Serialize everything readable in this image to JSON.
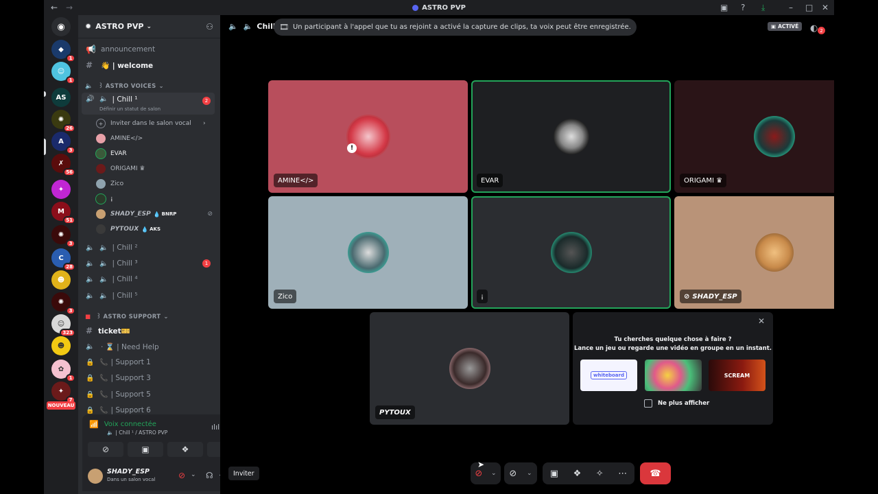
{
  "window": {
    "title": "ASTRO PVP"
  },
  "guilds": [
    {
      "badge": ""
    },
    {
      "badge": "1"
    },
    {
      "badge": "1"
    },
    {
      "badge": ""
    },
    {
      "badge": "26"
    },
    {
      "badge": "3"
    },
    {
      "badge": "56"
    },
    {
      "badge": ""
    },
    {
      "badge": "51"
    },
    {
      "badge": "3"
    },
    {
      "badge": "28"
    },
    {
      "badge": "3"
    },
    {
      "badge": "3"
    },
    {
      "badge": "323"
    },
    {
      "badge": ""
    },
    {
      "badge": "1"
    },
    {
      "badge": "7"
    }
  ],
  "guild_new_label": "NOUVEAU",
  "server": {
    "name": "ASTRO PVP"
  },
  "channels": {
    "announcement": "announcement",
    "welcome": "👋 | welcome",
    "cat_voices": "꒱ ASTRO VOICES",
    "chill1": "| Chill ¹",
    "chill1_badge": "2",
    "chill1_status": "Définir un statut de salon",
    "invite": "Inviter dans le salon vocal",
    "users": [
      "AMINE</>",
      "EVAR",
      "ORIGAMI ♛",
      "Zico",
      "¡",
      "𝙎𝙃𝘼𝘿𝙔_𝙀𝙎𝙋",
      "𝙋𝙔𝙏𝙊𝙐𝙓"
    ],
    "shady_tag": "BNRP",
    "pytoux_tag": "AKS",
    "chill2": "| Chill ²",
    "chill3": "| Chill ³",
    "chill3_badge": "1",
    "chill4": "| Chill ⁴",
    "chill5": "| Chill ⁵",
    "cat_support": "꒱ ASTRO SUPPORT",
    "ticket": "ticket🎫",
    "need_help": "· ⌛ | Need Help",
    "support1": "| Support 1",
    "support3": "| Support 3",
    "support5": "| Support 5",
    "support6": "| Support 6"
  },
  "voice_panel": {
    "status": "Voix connectée",
    "channel": "| Chill ¹ / ASTRO PVP"
  },
  "user_panel": {
    "name": "𝙎𝙃𝘼𝘿𝙔_𝙀𝙎𝙋",
    "status": "Dans un salon vocal"
  },
  "header": {
    "channel": "Chill",
    "toast": "Un participant à l'appel que tu as rejoint a activé la capture de clips, ta voix peut être enregistrée.",
    "active_label": "ACTIVÉ",
    "inbox_badge": "2"
  },
  "tiles": [
    {
      "name": "AMINE</>"
    },
    {
      "name": "EVAR"
    },
    {
      "name": "ORIGAMI ♛"
    },
    {
      "name": "Zico"
    },
    {
      "name": "¡"
    },
    {
      "name": "𝙎𝙃𝘼𝘿𝙔_𝙀𝙎𝙋"
    },
    {
      "name": "𝙋𝙔𝙏𝙊𝙐𝙓"
    }
  ],
  "activity": {
    "title": "Tu cherches quelque chose à faire ?",
    "subtitle": "Lance un jeu ou regarde une vidéo en groupe en un instant.",
    "card1": "whiteboard",
    "card3": "SCREAM",
    "checkbox": "Ne plus afficher"
  },
  "bottom": {
    "invite": "Inviter"
  },
  "colors": {
    "accent_green": "#23a55a",
    "danger": "#da373c",
    "blurple": "#5865f2"
  }
}
